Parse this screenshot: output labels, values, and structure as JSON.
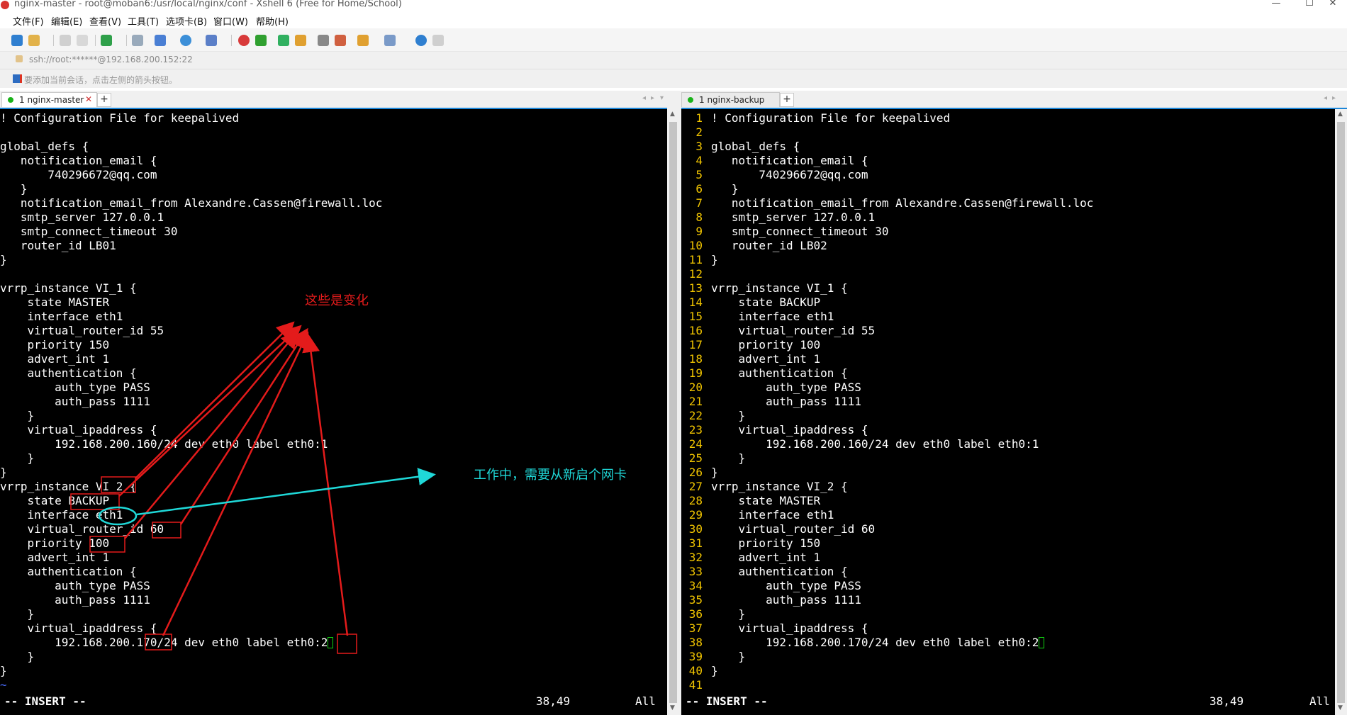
{
  "window": {
    "title": "nginx-master - root@moban6:/usr/local/nginx/conf - Xshell 6 (Free for Home/School)",
    "controls": [
      "—",
      "☐",
      "✕"
    ]
  },
  "menu": [
    "文件(F)",
    "编辑(E)",
    "查看(V)",
    "工具(T)",
    "选项卡(B)",
    "窗口(W)",
    "帮助(H)"
  ],
  "address": "ssh://root:******@192.168.200.152:22",
  "hint": "要添加当前会话，点击左侧的箭头按钮。",
  "tabs": {
    "left": {
      "label": "1 nginx-master",
      "close": "✕",
      "add": "+"
    },
    "right": {
      "label": "1 nginx-backup",
      "add": "+"
    }
  },
  "left_terminal": {
    "lines": [
      "! Configuration File for keepalived",
      "",
      "global_defs {",
      "   notification_email {",
      "       740296672@qq.com",
      "   }",
      "   notification_email_from Alexandre.Cassen@firewall.loc",
      "   smtp_server 127.0.0.1",
      "   smtp_connect_timeout 30",
      "   router_id LB01",
      "}",
      "",
      "vrrp_instance VI_1 {",
      "    state MASTER",
      "    interface eth1",
      "    virtual_router_id 55",
      "    priority 150",
      "    advert_int 1",
      "    authentication {",
      "        auth_type PASS",
      "        auth_pass 1111",
      "    }",
      "    virtual_ipaddress {",
      "        192.168.200.160/24 dev eth0 label eth0:1",
      "    }",
      "}",
      "vrrp_instance VI_2 {",
      "    state BACKUP",
      "    interface eth1",
      "    virtual_router_id 60",
      "    priority 100",
      "    advert_int 1",
      "    authentication {",
      "        auth_type PASS",
      "        auth_pass 1111",
      "    }",
      "    virtual_ipaddress {",
      "        192.168.200.170/24 dev eth0 label eth0:2",
      "    }",
      "}",
      "~"
    ],
    "mode": "-- INSERT --",
    "position": "38,49",
    "scroll": "All"
  },
  "right_terminal": {
    "lines": [
      "! Configuration File for keepalived",
      "",
      "global_defs {",
      "   notification_email {",
      "       740296672@qq.com",
      "   }",
      "   notification_email_from Alexandre.Cassen@firewall.loc",
      "   smtp_server 127.0.0.1",
      "   smtp_connect_timeout 30",
      "   router_id LB02",
      "}",
      "",
      "vrrp_instance VI_1 {",
      "    state BACKUP",
      "    interface eth1",
      "    virtual_router_id 55",
      "    priority 100",
      "    advert_int 1",
      "    authentication {",
      "        auth_type PASS",
      "        auth_pass 1111",
      "    }",
      "    virtual_ipaddress {",
      "        192.168.200.160/24 dev eth0 label eth0:1",
      "    }",
      "}",
      "vrrp_instance VI_2 {",
      "    state MASTER",
      "    interface eth1",
      "    virtual_router_id 60",
      "    priority 150",
      "    advert_int 1",
      "    authentication {",
      "        auth_type PASS",
      "        auth_pass 1111",
      "    }",
      "    virtual_ipaddress {",
      "        192.168.200.170/24 dev eth0 label eth0:2",
      "    }",
      "}",
      ""
    ],
    "mode": "-- INSERT --",
    "position": "38,49",
    "scroll": "All"
  },
  "annotations": {
    "changes": "这些是变化",
    "working": "工作中，需要从新启个网卡"
  },
  "colors": {
    "line_number": "#f0c400",
    "annotation_red": "#e41b1b",
    "annotation_cyan": "#1fd8d8",
    "tab_accent": "#1c86d9",
    "status_dot": "#19b319"
  }
}
